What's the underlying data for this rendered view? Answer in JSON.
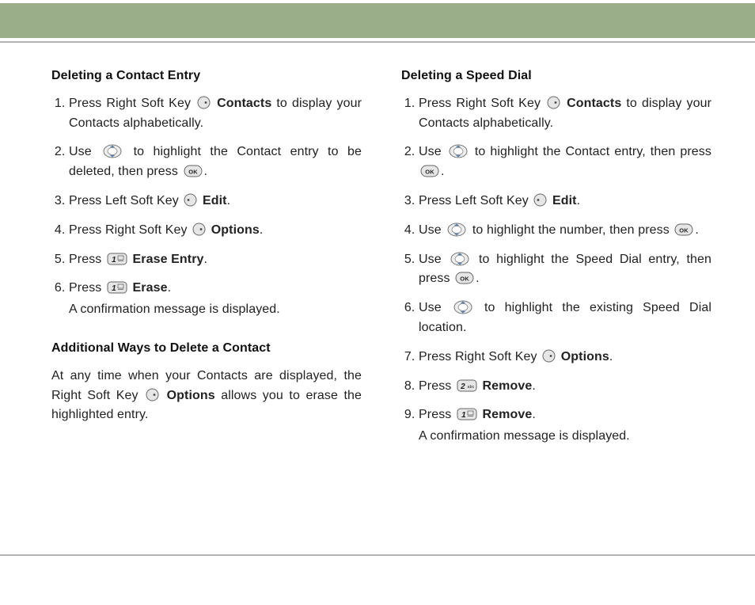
{
  "left": {
    "section1_title": "Deleting a Contact Entry",
    "s1": {
      "i1a": "Press Right Soft Key ",
      "i1b": " Contacts",
      "i1c": " to display your Contacts alphabetically.",
      "i2a": "Use ",
      "i2b": " to highlight the Contact entry to be deleted, then press ",
      "i2c": ".",
      "i3a": "Press Left Soft Key ",
      "i3b": " Edit",
      "i3c": ".",
      "i4a": "Press Right Soft Key ",
      "i4b": " Options",
      "i4c": ".",
      "i5a": "Press ",
      "i5b": " Erase Entry",
      "i5c": ".",
      "i6a": "Press ",
      "i6b": " Erase",
      "i6c": ".",
      "i6note": "A confirmation message is displayed."
    },
    "section2_title": "Additional Ways to Delete a Contact",
    "section2_body_a": "At any time when your Contacts are displayed, the Right Soft Key ",
    "section2_body_b": " Options",
    "section2_body_c": " allows you to erase the highlighted entry."
  },
  "right": {
    "section1_title": "Deleting a Speed Dial",
    "s1": {
      "i1a": "Press Right Soft Key ",
      "i1b": " Contacts",
      "i1c": " to display your Contacts alphabetically.",
      "i2a": "Use ",
      "i2b": " to highlight the Contact entry, then press ",
      "i2c": ".",
      "i3a": "Press Left Soft Key ",
      "i3b": " Edit",
      "i3c": ".",
      "i4a": "Use ",
      "i4b": " to highlight the number, then press ",
      "i4c": ".",
      "i5a": "Use ",
      "i5b": " to highlight the Speed Dial entry, then press ",
      "i5c": ".",
      "i6a": "Use ",
      "i6b": " to highlight the existing Speed Dial location.",
      "i7a": "Press Right Soft Key ",
      "i7b": " Options",
      "i7c": ".",
      "i8a": "Press ",
      "i8b": " Remove",
      "i8c": ".",
      "i9a": "Press ",
      "i9b": " Remove",
      "i9c": ".",
      "i9note": "A confirmation message is displayed."
    }
  },
  "keys": {
    "ok_label": "OK",
    "one": "1",
    "two": "2",
    "abc": "abc"
  }
}
